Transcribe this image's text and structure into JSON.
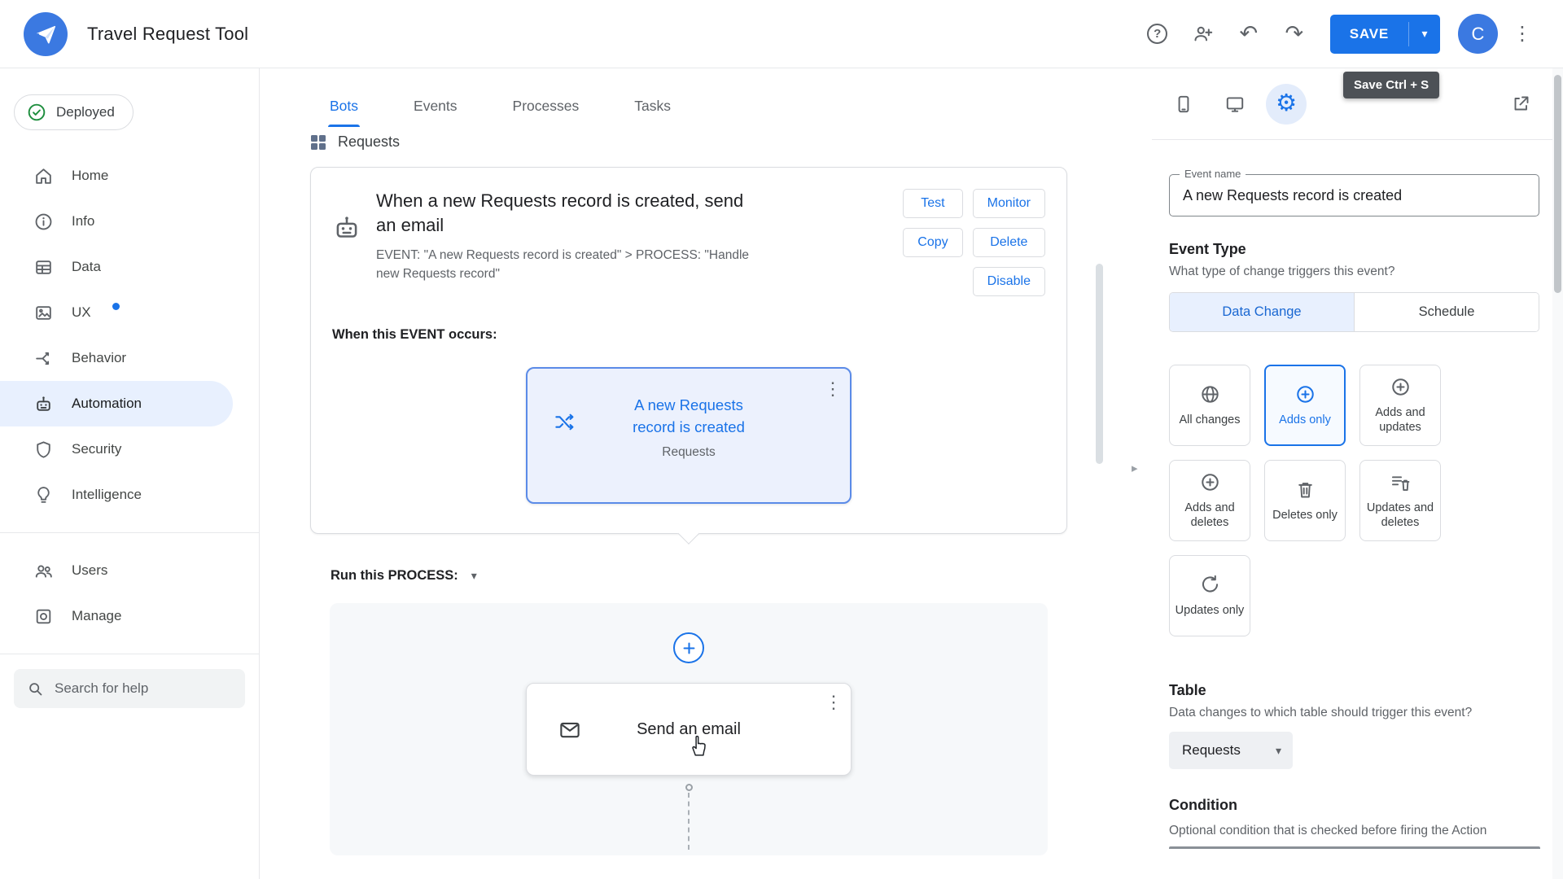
{
  "header": {
    "app_title": "Travel Request Tool",
    "save_label": "SAVE",
    "save_tooltip": "Save Ctrl + S",
    "avatar_initial": "C",
    "icons": [
      "help-icon",
      "add-person-icon",
      "undo-icon",
      "redo-icon",
      "more-vert-icon"
    ]
  },
  "sidebar": {
    "deployed_label": "Deployed",
    "items": [
      {
        "label": "Home",
        "icon": "home-icon"
      },
      {
        "label": "Info",
        "icon": "info-icon"
      },
      {
        "label": "Data",
        "icon": "data-icon"
      },
      {
        "label": "UX",
        "icon": "ux-icon",
        "badge_dot": true
      },
      {
        "label": "Behavior",
        "icon": "behavior-icon"
      },
      {
        "label": "Automation",
        "icon": "automation-icon",
        "selected": true
      },
      {
        "label": "Security",
        "icon": "security-icon"
      },
      {
        "label": "Intelligence",
        "icon": "intelligence-icon"
      }
    ],
    "secondary_items": [
      {
        "label": "Users",
        "icon": "users-icon"
      },
      {
        "label": "Manage",
        "icon": "manage-icon"
      }
    ],
    "search_placeholder": "Search for help"
  },
  "main": {
    "tabs": [
      {
        "label": "Bots",
        "selected": true
      },
      {
        "label": "Events"
      },
      {
        "label": "Processes"
      },
      {
        "label": "Tasks"
      }
    ],
    "breadcrumb": "Requests",
    "bot_card": {
      "title": "When a new Requests record is created, send an email",
      "subtitle": "EVENT: \"A new Requests record is created\" > PROCESS: \"Handle new Requests record\"",
      "actions": [
        "Test",
        "Monitor",
        "Copy",
        "Delete",
        "Disable"
      ],
      "event_section_label": "When this EVENT occurs:",
      "event_node": {
        "title": "A new Requests record is created",
        "table": "Requests"
      }
    },
    "process_section_label": "Run this PROCESS:",
    "step_card": {
      "title": "Send an email"
    }
  },
  "panel": {
    "toolbar_icons": [
      "phone-preview-icon",
      "desktop-preview-icon",
      "settings-icon",
      "open-in-new-icon"
    ],
    "event_name": {
      "label": "Event name",
      "value": "A new Requests record is created"
    },
    "event_type": {
      "heading": "Event Type",
      "question": "What type of change triggers this event?",
      "segments": [
        {
          "label": "Data Change",
          "selected": true
        },
        {
          "label": "Schedule"
        }
      ],
      "options": [
        {
          "label": "All changes",
          "icon": "globe-icon"
        },
        {
          "label": "Adds only",
          "icon": "plus-circle-icon",
          "selected": true
        },
        {
          "label": "Adds and updates",
          "icon": "plus-circle-icon"
        },
        {
          "label": "Adds and deletes",
          "icon": "plus-circle-icon"
        },
        {
          "label": "Deletes only",
          "icon": "trash-icon"
        },
        {
          "label": "Updates and deletes",
          "icon": "list-trash-icon"
        },
        {
          "label": "Updates only",
          "icon": "refresh-icon"
        }
      ]
    },
    "table": {
      "heading": "Table",
      "question": "Data changes to which table should trigger this event?",
      "value": "Requests"
    },
    "condition": {
      "heading": "Condition",
      "description": "Optional condition that is checked before firing the Action"
    }
  }
}
